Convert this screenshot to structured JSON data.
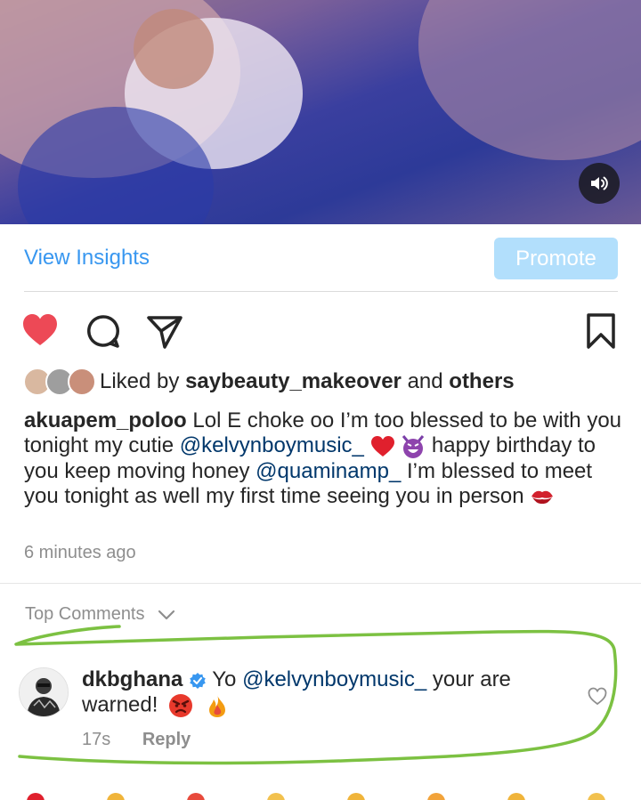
{
  "insights": {
    "view_label": "View Insights",
    "promote_label": "Promote"
  },
  "likes": {
    "prefix": "Liked by",
    "user": "saybeauty_makeover",
    "connector": "and",
    "others": "others"
  },
  "caption": {
    "username": "akuapem_poloo",
    "text_part1": "Lol E choke oo I’m too blessed to be with you tonight my cutie",
    "mention1": "@kelvynboymusic_",
    "text_part2": "happy birthday to you keep moving honey",
    "mention2": "@quaminamp_",
    "text_part3": "I’m blessed to meet you tonight as well my first time seeing you in person"
  },
  "timestamp": "6 minutes ago",
  "comments_header": "Top Comments",
  "comment": {
    "username": "dkbghana",
    "text_prefix": "Yo",
    "mention": "@kelvynboymusic_",
    "text_rest": "your are warned!",
    "time": "17s",
    "reply_label": "Reply"
  },
  "colors": {
    "link_blue": "#3897f0",
    "promote_bg": "#b2dffc",
    "like_red": "#ed4956",
    "mention_navy": "#00376b",
    "annotation_green": "#7cc142"
  }
}
